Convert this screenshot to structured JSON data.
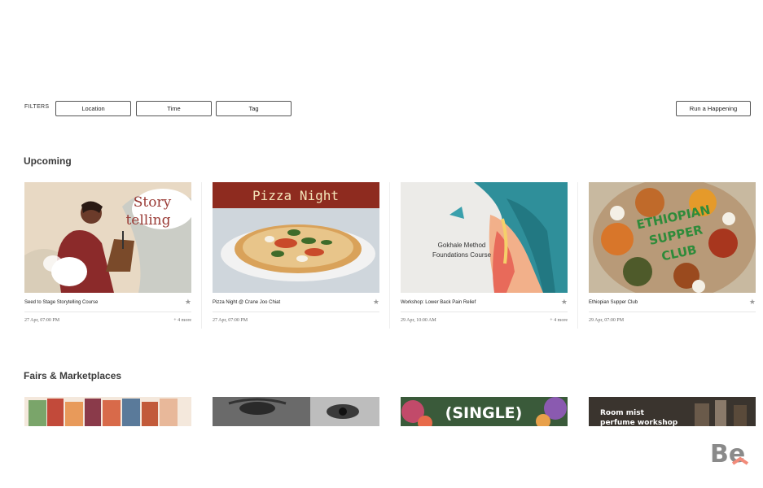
{
  "filters": {
    "label": "FILTERS",
    "location": "Location",
    "time": "Time",
    "tag": "Tag",
    "run_button": "Run a Happening"
  },
  "sections": {
    "upcoming": "Upcoming",
    "fairs": "Fairs & Marketplaces"
  },
  "cards": [
    {
      "title": "Seed to Stage Storytelling Course",
      "date": "27 Apr, 07:00 PM",
      "more": "+ 4 more",
      "art": [
        "Story",
        "telling"
      ]
    },
    {
      "title": "Pizza Night @ Crane Joo Chiat",
      "date": "27 Apr, 07:00 PM",
      "more": "",
      "art": [
        "Pizza Night"
      ]
    },
    {
      "title": "Workshop: Lower Back Pain Relief",
      "date": "29 Apr, 10:00 AM",
      "more": "+ 4 more",
      "art": [
        "Gokhale Method",
        "Foundations Course"
      ]
    },
    {
      "title": "Ethiopian Supper Club",
      "date": "29 Apr, 07:00 PM",
      "more": "",
      "art": [
        "ETHIOPIAN",
        "SUPPER",
        "CLUB"
      ]
    }
  ],
  "fairs": [
    {
      "art": ""
    },
    {
      "art": ""
    },
    {
      "art": "(SINGLE)"
    },
    {
      "art": [
        "Room mist",
        "perfume workshop"
      ]
    }
  ],
  "watermark": "Be",
  "colors": {
    "pill_border": "#555555",
    "star": "#9a9a9a",
    "watermark_gray": "#8a8a8a",
    "watermark_pink": "#f28b7a"
  }
}
